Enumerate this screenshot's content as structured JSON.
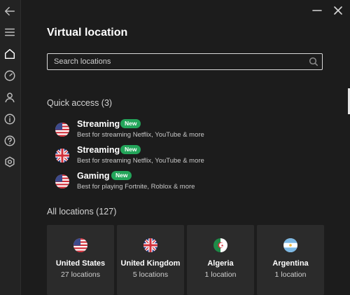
{
  "page": {
    "title": "Virtual location"
  },
  "search": {
    "placeholder": "Search locations"
  },
  "quick_access": {
    "heading": "Quick access (3)",
    "items": [
      {
        "name": "Streaming",
        "badge": "New",
        "desc": "Best for streaming Netflix, YouTube & more",
        "flag": "us-flag-icon"
      },
      {
        "name": "Streaming",
        "badge": "New",
        "desc": "Best for streaming Netflix, YouTube & more",
        "flag": "uk-flag-icon"
      },
      {
        "name": "Gaming",
        "badge": "New",
        "desc": "Best for playing Fortnite, Roblox & more",
        "flag": "us-flag-icon"
      }
    ]
  },
  "all_locations": {
    "heading": "All locations (127)",
    "cards": [
      {
        "name": "United States",
        "count": "27 locations",
        "flag": "us-flag-icon"
      },
      {
        "name": "United Kingdom",
        "count": "5 locations",
        "flag": "uk-flag-icon"
      },
      {
        "name": "Algeria",
        "count": "1 location",
        "flag": "algeria-flag-icon"
      },
      {
        "name": "Argentina",
        "count": "1 location",
        "flag": "argentina-flag-icon"
      }
    ]
  },
  "colors": {
    "background": "#1c1c1c",
    "card": "#2b2b2b",
    "badge": "#23a55a",
    "sidebar": "#232323"
  }
}
